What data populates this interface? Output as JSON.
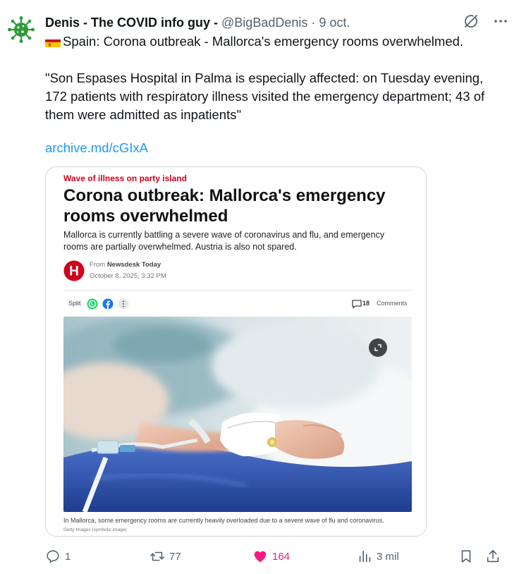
{
  "author": {
    "name": "Denis - The COVID info guy -",
    "handle": "@BigBadDenis",
    "separator": "·",
    "date": "9 oct."
  },
  "post": {
    "line1": "Spain: Corona outbreak - Mallorca's emergency rooms overwhelmed.",
    "quote": "\"Son Espases Hospital in Palma is especially affected: on Tuesday evening, 172 patients with respiratory illness visited the emergency department; 43 of them were admitted as inpatients\"",
    "link": "archive.md/cGIxA"
  },
  "article": {
    "kicker": "Wave of illness on party island",
    "headline": "Corona outbreak: Mallorca's emergency rooms overwhelmed",
    "lede": "Mallorca is currently battling a severe wave of coronavirus and flu, and emergency rooms are partially overwhelmed. Austria is also not spared.",
    "source_prefix": "From",
    "source_name": "Newsdesk Today",
    "source_date": "October 8, 2025, 3:32 PM",
    "logo_letter": "H",
    "split_label": "Split",
    "comments_count": "18",
    "comments_label": "Comments",
    "caption": "In Mallorca, some emergency rooms are currently heavily overloaded due to a severe wave of flu and coronavirus.",
    "credit": "Getty Images (symbolic image)"
  },
  "actions": {
    "replies": "1",
    "reposts": "77",
    "likes": "164",
    "views": "3 mil"
  },
  "colors": {
    "accent_link": "#1d9bf0",
    "like_pink": "#f91880",
    "kicker_red": "#d1001c",
    "avatar_green": "#2e9b3a"
  }
}
